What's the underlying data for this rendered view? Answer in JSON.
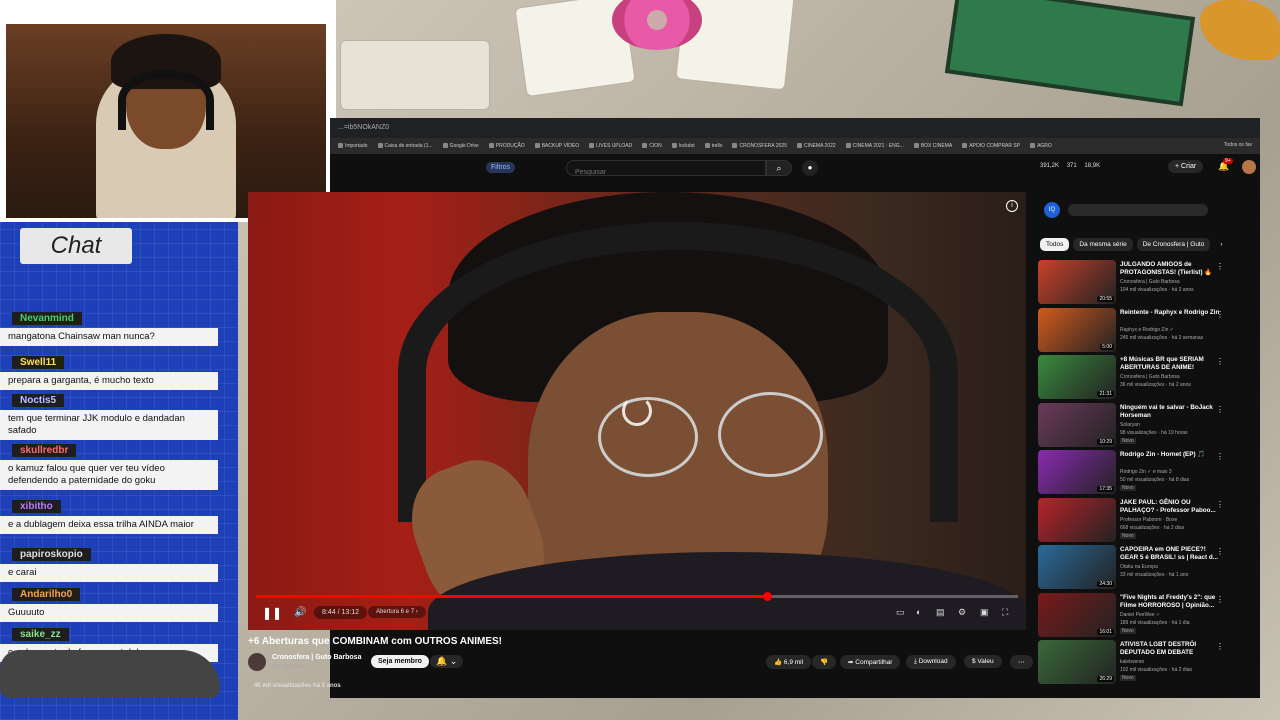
{
  "chat": {
    "title": "Chat",
    "messages": [
      {
        "user": "Nevanmind",
        "text": "mangatona Chainsaw man nunca?",
        "color": "#46d36b"
      },
      {
        "user": "Swell11",
        "text": "prepara a garganta, é mucho texto",
        "color": "#ffe14d"
      },
      {
        "user": "Noctis5",
        "text": "tem que terminar JJK modulo e dandadan safado",
        "color": "#b9c4ff"
      },
      {
        "user": "skullredbr",
        "text": "o kamuz falou que quer ver teu vídeo defendendo a paternidade do goku",
        "color": "#ff6a6a"
      },
      {
        "user": "xibitho",
        "text": "e a dublagem deixa essa trilha AINDA maior",
        "color": "#b77bff"
      },
      {
        "user": "papiroskopio",
        "text": "e carai",
        "color": "#dddddd"
      },
      {
        "user": "Andarilho0",
        "text": "Guuuuto",
        "color": "#ffa43c"
      },
      {
        "user": "saike_zz",
        "text": "o caba gosta de fazer react dele mesmo",
        "color": "#8ee08b"
      }
    ]
  },
  "browser": {
    "url": "...=ib5NOkANZ0",
    "bookmarks": [
      "Importado",
      "Caixa de entrada (1...",
      "Google Drive",
      "PRODUÇÃO",
      "BACKUP VÍDEO",
      "LIVES UPLOAD",
      "CION",
      "lockdot",
      "trello",
      "CRONOSFERA 2025",
      "CINEMA 2022",
      "CINEMA 2021 · ENG...",
      "BOX CINEMA",
      "APOIO COMPRAR SP",
      "AGRO"
    ],
    "bookmarks_right": "Todos os fav"
  },
  "yt_header": {
    "filters": "Filtros",
    "search_placeholder": "Pesquisar",
    "stats": [
      "391,2K",
      "371",
      "18,9K"
    ],
    "criar": "+ Criar",
    "notif_count": "9+"
  },
  "player": {
    "time": "8:44 / 13:12",
    "chapter": "Abertura 6 e 7 ›",
    "progress": 0.67
  },
  "video": {
    "title": "+6 Aberturas que COMBINAM com OUTROS ANIMES!",
    "channel": "Cronosfera | Guto Barbosa",
    "subscribers": "848 mil inscritos",
    "join": "Seja membro",
    "likes": "6,9 mil",
    "share": "Compartilhar",
    "download": "Download",
    "thanks": "Valeu",
    "views_line": "45 mil visualizações  há 2 anos"
  },
  "sidebar": {
    "live_chip": "IQ",
    "chips": [
      "Todos",
      "Da mesma série",
      "De Cronosfera | Guto"
    ],
    "recs": [
      {
        "title": "JULGANDO AMIGOS de PROTAGONISTAS! (Tierlist) 🔥",
        "channel": "Cronosfera | Guto Barbosa",
        "meta": "104 mil visualizações · há 3 anos",
        "duration": "20:55",
        "badge": "",
        "color": "#c9412a"
      },
      {
        "title": "Reintente - Raphyx e Rodrigo Zin",
        "channel": "Raphyx e Rodrigo Zin ✓",
        "meta": "245 mil visualizações · há 3 semanas",
        "duration": "5:00",
        "badge": "",
        "color": "#d25a1e"
      },
      {
        "title": "+8 Músicas BR que SERIAM ABERTURAS DE ANIME!",
        "channel": "Cronosfera | Guto Barbosa",
        "meta": "36 mil visualizações · há 2 anos",
        "duration": "21:31",
        "badge": "",
        "color": "#3a8a3d"
      },
      {
        "title": "Ninguém vai te salvar - BoJack Horseman",
        "channel": "Solaryan",
        "meta": "98 visualizações · há 19 horas",
        "duration": "10:29",
        "badge": "Novo",
        "color": "#6b3a5a"
      },
      {
        "title": "Rodrigo Zin - Hornet (EP) 🎵",
        "channel": "Rodrigo Zin ✓ e mais 3",
        "meta": "50 mil visualizações · há 8 dias",
        "duration": "17:35",
        "badge": "Novo",
        "color": "#8a2ab0"
      },
      {
        "title": "JAKE PAUL: GÊNIO OU PALHAÇO? - Professor Paboo...",
        "channel": "Professor Paboom · Boxe",
        "meta": "668 visualizações · há 2 dias",
        "duration": "",
        "badge": "Novo",
        "color": "#b8232a"
      },
      {
        "title": "CAPOEIRA em ONE PIECE?! GEAR 5 é BRASIL! ss | React d...",
        "channel": "Otaku na Europa",
        "meta": "33 mil visualizações · há 1 ano",
        "duration": "24:30",
        "badge": "",
        "color": "#2a6a9a"
      },
      {
        "title": "\"Five Nights at Freddy's 2\": que Filme HORROROSO | Opinião...",
        "channel": "Daniel PeeWee ✓",
        "meta": "189 mil visualizações · há 1 dia",
        "duration": "16:01",
        "badge": "Novo",
        "color": "#7a1a1a"
      },
      {
        "title": "ATIVISTA LGBT DESTRÓI DEPUTADO EM DEBATE",
        "channel": "kalebverso",
        "meta": "102 mil visualizações · há 2 dias",
        "duration": "26:29",
        "badge": "Novo",
        "color": "#3a6a3a"
      }
    ]
  }
}
